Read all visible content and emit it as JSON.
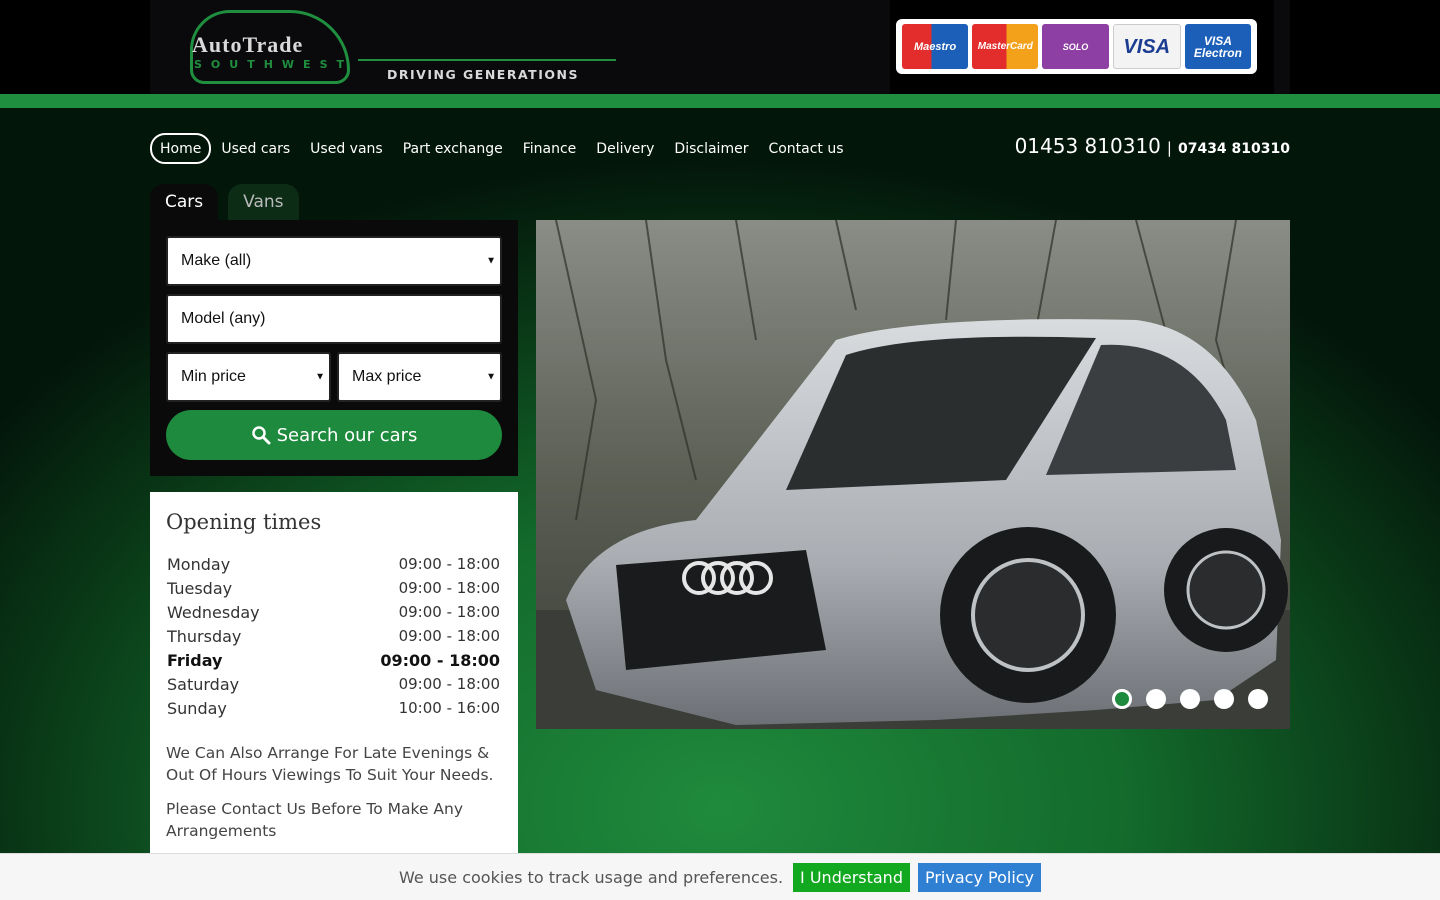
{
  "brand": {
    "name_top": "AutoTrade",
    "name_bottom": "SOUTHWEST",
    "tagline": "DRIVING GENERATIONS"
  },
  "payment_cards": [
    "Maestro",
    "MasterCard",
    "SOLO",
    "VISA",
    "VISA Electron"
  ],
  "nav": {
    "items": [
      "Home",
      "Used cars",
      "Used vans",
      "Part exchange",
      "Finance",
      "Delivery",
      "Disclaimer",
      "Contact us"
    ],
    "active": "Home"
  },
  "phone": {
    "main": "01453 810310",
    "separator": "|",
    "alt": "07434 810310"
  },
  "search": {
    "tabs": [
      "Cars",
      "Vans"
    ],
    "active_tab": "Cars",
    "make": "Make (all)",
    "model": "Model (any)",
    "min_price": "Min price",
    "max_price": "Max price",
    "button": "Search our cars"
  },
  "opening_times": {
    "title": "Opening times",
    "rows": [
      {
        "day": "Monday",
        "time": "09:00 - 18:00"
      },
      {
        "day": "Tuesday",
        "time": "09:00 - 18:00"
      },
      {
        "day": "Wednesday",
        "time": "09:00 - 18:00"
      },
      {
        "day": "Thursday",
        "time": "09:00 - 18:00"
      },
      {
        "day": "Friday",
        "time": "09:00 - 18:00"
      },
      {
        "day": "Saturday",
        "time": "09:00 - 18:00"
      },
      {
        "day": "Sunday",
        "time": "10:00 - 16:00"
      }
    ],
    "today": "Friday",
    "note1": "We Can Also Arrange For Late Evenings & Out Of Hours Viewings To Suit Your Needs.",
    "note2": "Please Contact Us Before To  Make Any Arrangements"
  },
  "slider": {
    "slide_count": 5,
    "active_slide": 1
  },
  "cookie": {
    "text": "We use cookies to track usage and preferences.",
    "accept": "I Understand",
    "policy": "Privacy Policy"
  },
  "colors": {
    "brand_green": "#1f8f3f",
    "accept_green": "#12a81f",
    "policy_blue": "#2f7fd3"
  }
}
